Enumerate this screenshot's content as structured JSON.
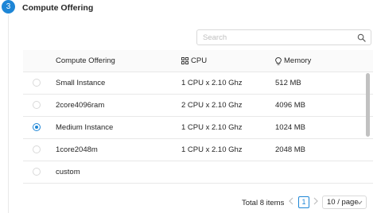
{
  "step": {
    "number": "3",
    "title": "Compute Offering"
  },
  "search": {
    "placeholder": "Search"
  },
  "table": {
    "headers": {
      "name": "Compute Offering",
      "cpu": "CPU",
      "memory": "Memory"
    },
    "rows": [
      {
        "name": "Small Instance",
        "cpu": "1 CPU x 2.10 Ghz",
        "memory": "512 MB",
        "selected": false
      },
      {
        "name": "2core4096ram",
        "cpu": "2 CPU x 2.10 Ghz",
        "memory": "4096 MB",
        "selected": false
      },
      {
        "name": "Medium Instance",
        "cpu": "1 CPU x 2.10 Ghz",
        "memory": "1024 MB",
        "selected": true
      },
      {
        "name": "1core2048m",
        "cpu": "1 CPU x 2.10 Ghz",
        "memory": "2048 MB",
        "selected": false
      },
      {
        "name": "custom",
        "cpu": "",
        "memory": "",
        "selected": false
      }
    ]
  },
  "pagination": {
    "total": "Total 8 items",
    "current_page": "1",
    "page_size": "10 / page"
  },
  "colors": {
    "accent": "#1e86d6",
    "border": "#e8e8e8",
    "header_bg": "#fafafa"
  },
  "icons": {
    "search": "search-icon",
    "cpu": "cpu-grid-icon",
    "memory": "bulb-icon",
    "prev": "chevron-left-icon",
    "next": "chevron-right-icon",
    "dropdown": "chevron-down-icon"
  }
}
